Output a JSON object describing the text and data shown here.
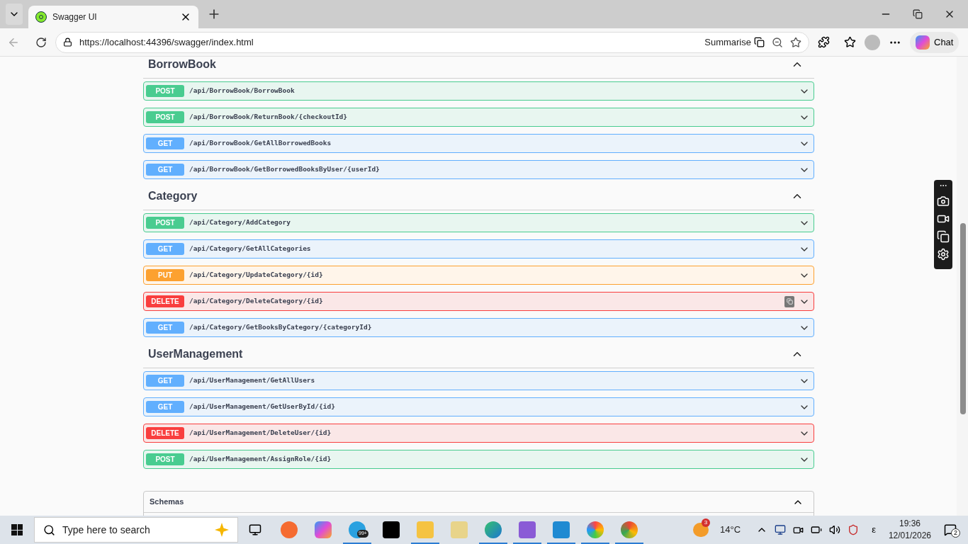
{
  "browser": {
    "tab_title": "Swagger UI",
    "url": "https://localhost:44396/swagger/index.html",
    "summarise": "Summarise",
    "chat": "Chat"
  },
  "sections": [
    {
      "name": "BorrowBook",
      "expanded": true,
      "operations": [
        {
          "method": "POST",
          "path": "/api/BorrowBook/BorrowBook"
        },
        {
          "method": "POST",
          "path": "/api/BorrowBook/ReturnBook/{checkoutId}"
        },
        {
          "method": "GET",
          "path": "/api/BorrowBook/GetAllBorrowedBooks"
        },
        {
          "method": "GET",
          "path": "/api/BorrowBook/GetBorrowedBooksByUser/{userId}"
        }
      ]
    },
    {
      "name": "Category",
      "expanded": true,
      "operations": [
        {
          "method": "POST",
          "path": "/api/Category/AddCategory"
        },
        {
          "method": "GET",
          "path": "/api/Category/GetAllCategories"
        },
        {
          "method": "PUT",
          "path": "/api/Category/UpdateCategory/{id}"
        },
        {
          "method": "DELETE",
          "path": "/api/Category/DeleteCategory/{id}",
          "clip_icon": true
        },
        {
          "method": "GET",
          "path": "/api/Category/GetBooksByCategory/{categoryId}"
        }
      ]
    },
    {
      "name": "UserManagement",
      "expanded": true,
      "operations": [
        {
          "method": "GET",
          "path": "/api/UserManagement/GetAllUsers"
        },
        {
          "method": "GET",
          "path": "/api/UserManagement/GetUserById/{id}"
        },
        {
          "method": "DELETE",
          "path": "/api/UserManagement/DeleteUser/{id}"
        },
        {
          "method": "POST",
          "path": "/api/UserManagement/AssignRole/{id}"
        }
      ]
    }
  ],
  "schemas": {
    "title": "Schemas",
    "expanded": true
  },
  "taskbar": {
    "search_placeholder": "Type here to search",
    "telegram_badge": "99+",
    "weather_badge": "3",
    "temperature": "14°C",
    "input_language": "ε",
    "time": "19:36",
    "date": "12/01/2026",
    "notifications": "2"
  }
}
